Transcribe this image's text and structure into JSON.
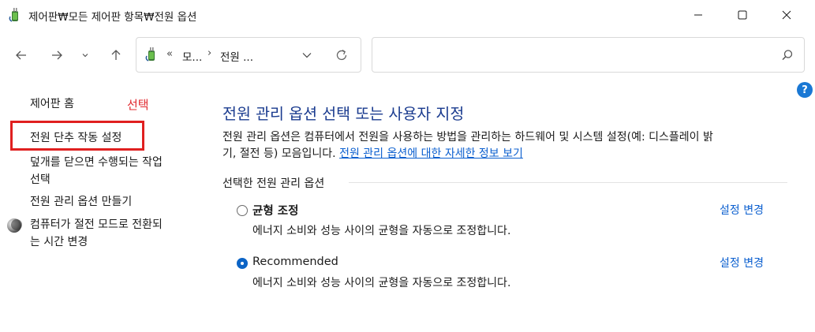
{
  "window": {
    "title": "제어판₩모든 제어판 항목₩전원 옵션"
  },
  "address": {
    "chevrons": "«",
    "crumbs": [
      "모...",
      "전원 ..."
    ],
    "separator": "›"
  },
  "search": {
    "placeholder": "",
    "value": ""
  },
  "help": {
    "label": "?"
  },
  "sidebar": {
    "home": "제어판 홈",
    "annotation": "선택",
    "items": [
      {
        "label": "전원 단추 작동 설정"
      },
      {
        "label_line1": "덮개를 닫으면 수행되는 작업",
        "label_line2": "선택"
      },
      {
        "label": "전원 관리 옵션 만들기"
      },
      {
        "label_line1": "컴퓨터가 절전 모드로 전환되",
        "label_line2": "는 시간 변경"
      }
    ]
  },
  "main": {
    "title": "전원 관리 옵션 선택 또는 사용자 지정",
    "description_line1": "전원 관리 옵션은 컴퓨터에서 전원을 사용하는 방법을 관리하는 하드웨어 및 시스템 설정(예: 디스플레이 밝",
    "description_line2": "기, 절전 등) 모음입니다.",
    "more_info_link": "전원 관리 옵션에 대한 자세한 정보 보기",
    "section_heading": "선택한 전원 관리 옵션",
    "plans": [
      {
        "name": "균형 조정",
        "selected": false,
        "description": "에너지 소비와 성능 사이의 균형을 자동으로 조정합니다.",
        "change_label": "설정 변경"
      },
      {
        "name": "Recommended",
        "selected": true,
        "description": "에너지 소비와 성능 사이의 균형을 자동으로 조정합니다.",
        "change_label": "설정 변경"
      }
    ]
  },
  "colors": {
    "accent": "#0c64c6",
    "link": "#0b5fcf",
    "title": "#1a3b8f",
    "highlight": "#e02020"
  }
}
